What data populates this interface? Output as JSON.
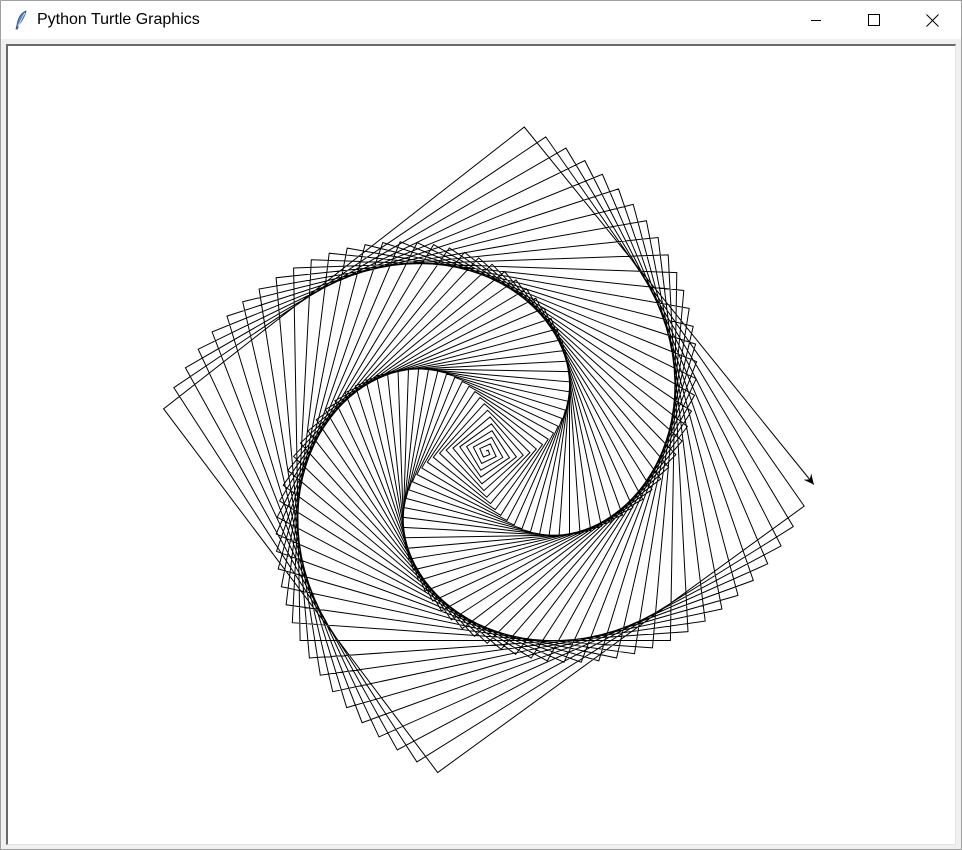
{
  "window": {
    "title": "Python Turtle Graphics",
    "app_icon": "feather-icon",
    "controls": [
      "minimize-icon",
      "maximize-icon",
      "close-icon"
    ]
  },
  "canvas": {
    "background": "#ffffff",
    "pen_color": "#000000",
    "drawing": "square spiral",
    "turtle_shape": "classic-arrow"
  },
  "colors": {
    "titlebar": "#ffffff",
    "frame": "#f0f0f0",
    "icon_blue": "#3f6fb5"
  }
}
